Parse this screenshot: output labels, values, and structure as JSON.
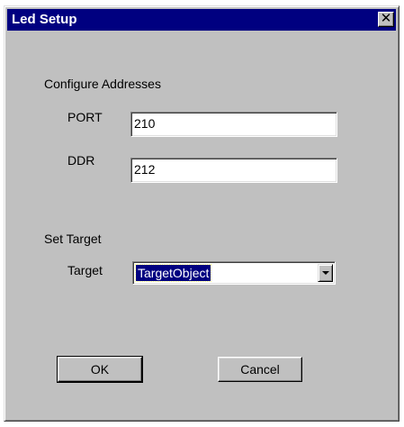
{
  "window": {
    "title": "Led Setup",
    "close_glyph": "✕",
    "close_icon": "close-icon"
  },
  "addresses": {
    "heading": "Configure Addresses",
    "port_label": "PORT",
    "port_value": "210",
    "ddr_label": "DDR",
    "ddr_value": "212"
  },
  "target": {
    "heading": "Set Target",
    "label": "Target",
    "selected": "TargetObject",
    "dropdown_icon": "chevron-down-icon"
  },
  "buttons": {
    "ok_label": "OK",
    "cancel_label": "Cancel"
  },
  "colors": {
    "titlebar": "#000080",
    "face": "#c0c0c0",
    "selection": "#000080"
  }
}
